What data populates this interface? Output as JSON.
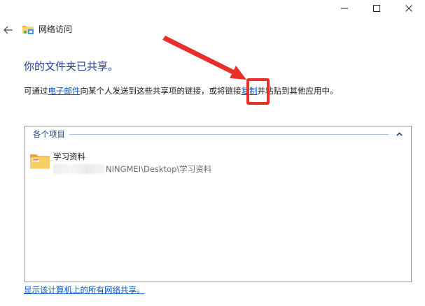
{
  "nav": {
    "title": "网络访问"
  },
  "main": {
    "heading": "你的文件夹已共享。",
    "instructions": {
      "prefix": "可通过",
      "email_link": "电子邮件",
      "middle": "向某个人发送到这些共享项的链接，或将链接",
      "copy_link": "复制",
      "suffix": "并粘贴到其他应用中。"
    },
    "items_group": {
      "label": "各个项目",
      "items": [
        {
          "name": "学习资料",
          "path_visible": "NINGMEI\\Desktop\\学习资料"
        }
      ]
    },
    "footer_link": "显示该计算机上的所有网络共享。"
  },
  "icons": {
    "back": "back-arrow-icon",
    "nav": "network-folder-icon",
    "folder": "shared-folder-icon",
    "collapse": "chevron-up-icon",
    "minimize": "minimize-icon",
    "maximize": "maximize-icon",
    "close": "close-icon"
  },
  "colors": {
    "heading": "#1e3e8e",
    "link": "#0a58c4",
    "annotation": "#e8302a",
    "group_line": "#a9c0e4"
  }
}
